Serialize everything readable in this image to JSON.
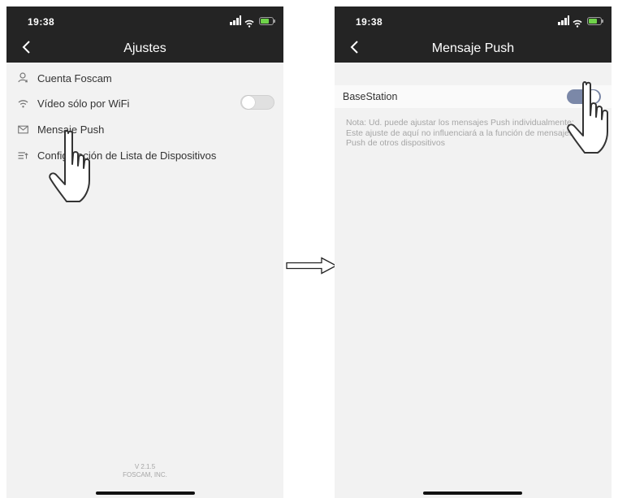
{
  "left": {
    "status_time": "19:38",
    "title": "Ajustes",
    "items": [
      {
        "icon": "user-icon",
        "label": "Cuenta Foscam"
      },
      {
        "icon": "wifi-icon",
        "label": "Vídeo sólo por WiFi",
        "toggle": false
      },
      {
        "icon": "envelope-icon",
        "label": "Mensaje Push"
      },
      {
        "icon": "list-settings-icon",
        "label": "Configuración de Lista de Dispositivos"
      }
    ],
    "version": "V 2.1.5",
    "company": "FOSCAM, INC."
  },
  "right": {
    "status_time": "19:38",
    "title": "Mensaje Push",
    "row_label": "BaseStation",
    "row_toggle": true,
    "note": "Nota: Ud. puede ajustar los mensajes Push individualmente: Este ajuste de aquí no influenciará a la función de mensajes Push de otros dispositivos"
  }
}
